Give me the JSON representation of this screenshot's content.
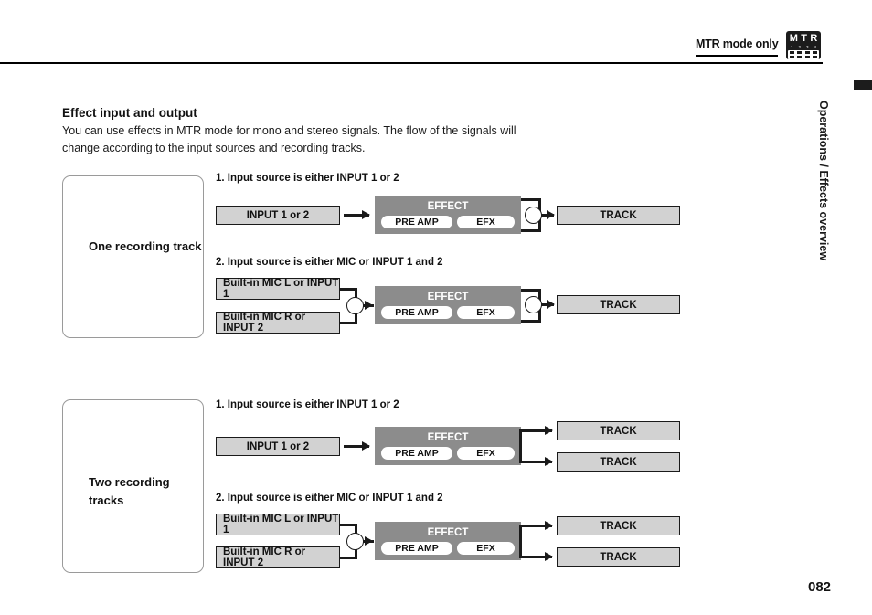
{
  "header": {
    "mode_label": "MTR mode only",
    "badge": {
      "word": "MTR",
      "letters": [
        "M",
        "T",
        "R"
      ],
      "numbers": [
        "1",
        "2",
        "3",
        "4"
      ]
    }
  },
  "sidebar": {
    "section_label": "Operations / Effects overview"
  },
  "section": {
    "title": "Effect input and output",
    "paragraph": "You can use effects in MTR mode for mono and stereo signals. The flow of the signals will change according to the input sources and recording tracks."
  },
  "colors": {
    "box_fill": "#d2d2d2",
    "effect_fill": "#8c8c8c",
    "pill_fill": "#ffffff",
    "line": "#1a1a1a",
    "panel_border": "#9a9a9a"
  },
  "effect_block": {
    "title": "EFFECT",
    "pre_amp": "PRE AMP",
    "efx": "EFX"
  },
  "diagrams": [
    {
      "panel_label": "One recording track",
      "cases": [
        {
          "step": "1. Input source is either INPUT 1 or 2",
          "inputs": [
            "INPUT 1 or 2"
          ],
          "outputs": [
            "TRACK"
          ]
        },
        {
          "step": "2. Input source is either MIC or INPUT 1 and 2",
          "inputs": [
            "Built-in MIC L or INPUT 1",
            "Built-in MIC R or INPUT 2"
          ],
          "outputs": [
            "TRACK"
          ]
        }
      ]
    },
    {
      "panel_label": "Two recording tracks",
      "cases": [
        {
          "step": "1. Input source is either INPUT 1 or 2",
          "inputs": [
            "INPUT 1 or 2"
          ],
          "outputs": [
            "TRACK",
            "TRACK"
          ]
        },
        {
          "step": "2. Input source is either MIC or INPUT 1 and 2",
          "inputs": [
            "Built-in MIC L or INPUT 1",
            "Built-in MIC R or INPUT 2"
          ],
          "outputs": [
            "TRACK",
            "TRACK"
          ]
        }
      ]
    }
  ],
  "footer": {
    "page_number": "082"
  }
}
